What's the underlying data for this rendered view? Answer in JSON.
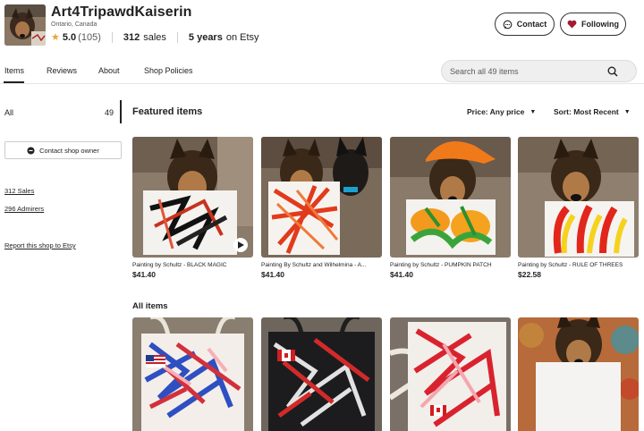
{
  "shop": {
    "name": "Art4TripawdKaiserin",
    "location": "Ontario, Canada",
    "rating": "5.0",
    "rating_count": "(105)",
    "sales_count": "312",
    "sales_label": "sales",
    "years_value": "5 years",
    "years_suffix": "on Etsy"
  },
  "header_buttons": {
    "contact": "Contact",
    "following": "Following"
  },
  "nav": {
    "tabs": [
      "Items",
      "Reviews",
      "About",
      "Shop Policies"
    ],
    "search_placeholder": "Search all 49 items"
  },
  "sidebar": {
    "all_label": "All",
    "all_count": "49",
    "contact_owner": "Contact shop owner",
    "sales_link": "312 Sales",
    "admirers_link": "296 Admirers",
    "report_link": "Report this shop to Etsy"
  },
  "featured": {
    "title": "Featured items",
    "price_filter": "Price: Any price",
    "sort": "Sort: Most Recent",
    "items": [
      {
        "title": "Painting by Schultz - BLACK MAGIC",
        "price": "$41.40"
      },
      {
        "title": "Painting By Schultz and Wilhelmina - A...",
        "price": "$41.40"
      },
      {
        "title": "Painting by Schultz - PUMPKIN PATCH",
        "price": "$41.40"
      },
      {
        "title": "Painting by Schultz - RULE OF THREES",
        "price": "$22.58"
      }
    ]
  },
  "all_items": {
    "title": "All items"
  },
  "colors": {
    "accent_heart": "#a61a2e",
    "star": "#e8a33d"
  }
}
